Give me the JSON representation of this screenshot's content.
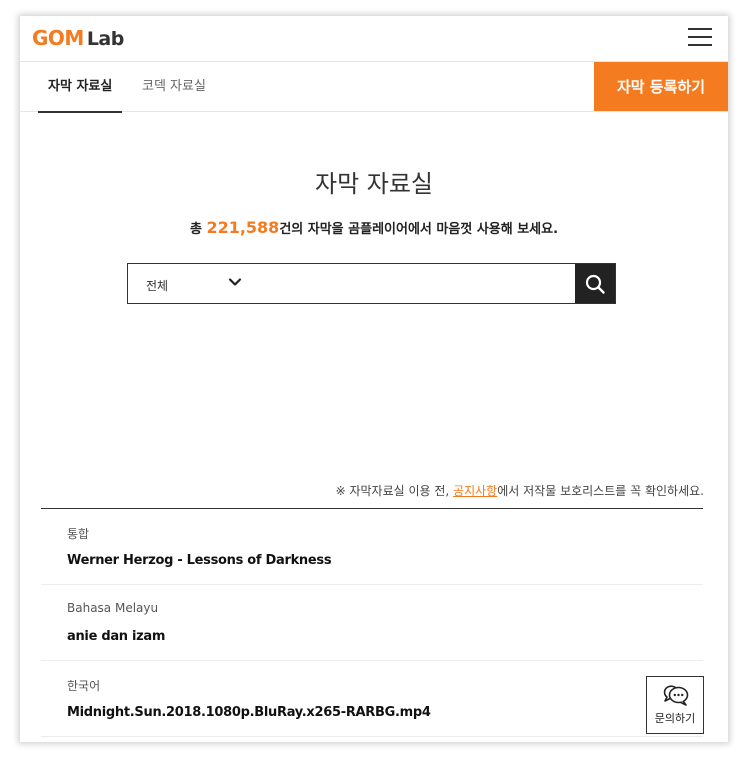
{
  "header": {
    "logo_gom": "GOM",
    "logo_lab": "Lab"
  },
  "tabs": [
    {
      "label": "자막 자료실",
      "active": true
    },
    {
      "label": "코덱 자료실",
      "active": false
    }
  ],
  "register_button": "자막 등록하기",
  "main": {
    "title": "자막 자료실",
    "subtitle_prefix": "총 ",
    "subtitle_count": "221,588",
    "subtitle_suffix": "건의 자막을 곰플레이어에서 마음껏 사용해 보세요."
  },
  "search": {
    "category_selected": "전체",
    "input_value": "",
    "icons": {
      "dropdown": "chevron-down-icon",
      "submit": "search-icon"
    }
  },
  "notice": {
    "prefix": "※ 자막자료실 이용 전, ",
    "link": "공지사항",
    "suffix": "에서 저작물 보호리스트를 꼭 확인하세요."
  },
  "subtitles": [
    {
      "lang": "통합",
      "title": "Werner Herzog - Lessons of Darkness"
    },
    {
      "lang": "Bahasa Melayu",
      "title": "anie dan izam"
    },
    {
      "lang": "한국어",
      "title": "Midnight.Sun.2018.1080p.BluRay.x265-RARBG.mp4"
    }
  ],
  "inquiry": {
    "label": "문의하기",
    "icon": "chat-bubble-icon"
  },
  "colors": {
    "accent": "#f47b20",
    "dark": "#222222"
  }
}
